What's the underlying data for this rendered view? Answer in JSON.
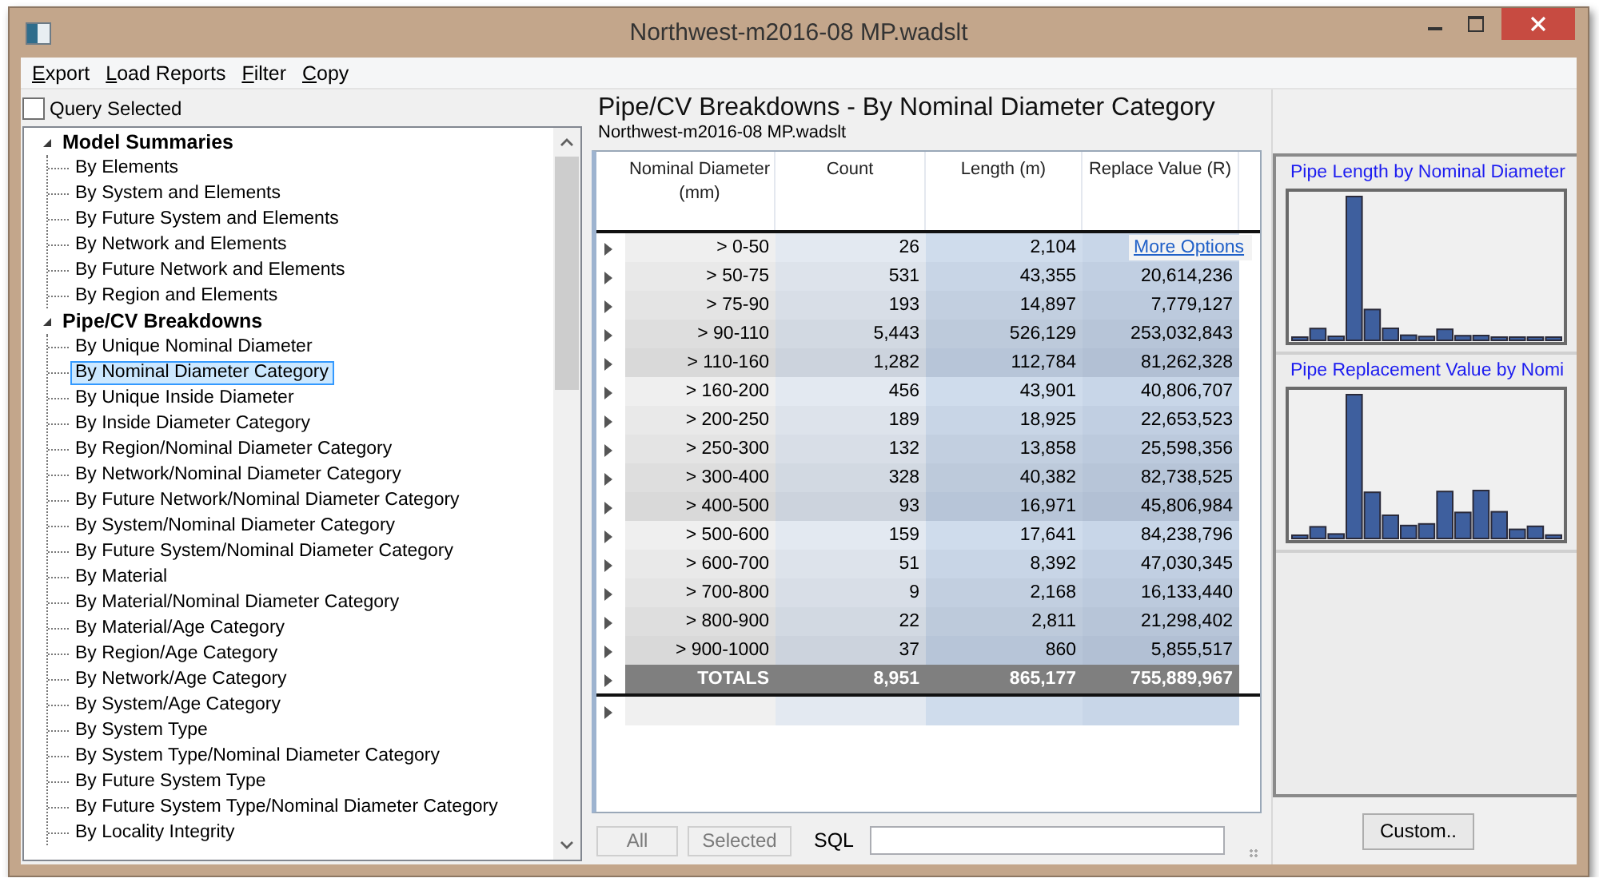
{
  "window": {
    "title": "Northwest-m2016-08 MP.wadslt"
  },
  "menu": [
    {
      "label": "Export"
    },
    {
      "label": "Load Reports"
    },
    {
      "label": "Filter"
    },
    {
      "label": "Copy"
    }
  ],
  "query_selected": {
    "label": "Query Selected",
    "checked": false
  },
  "tree": [
    {
      "label": "Model Summaries",
      "expanded": true,
      "children": [
        {
          "label": "By Elements",
          "selected": false
        },
        {
          "label": "By System and Elements",
          "selected": false
        },
        {
          "label": "By Future System and Elements",
          "selected": false
        },
        {
          "label": "By Network and Elements",
          "selected": false
        },
        {
          "label": "By Future Network and Elements",
          "selected": false
        },
        {
          "label": "By Region and Elements",
          "selected": false
        }
      ]
    },
    {
      "label": "Pipe/CV Breakdowns",
      "expanded": true,
      "children": [
        {
          "label": "By Unique Nominal Diameter",
          "selected": false
        },
        {
          "label": "By Nominal Diameter Category",
          "selected": true
        },
        {
          "label": "By Unique Inside Diameter",
          "selected": false
        },
        {
          "label": "By Inside Diameter Category",
          "selected": false
        },
        {
          "label": "By Region/Nominal Diameter Category",
          "selected": false
        },
        {
          "label": "By Network/Nominal Diameter Category",
          "selected": false
        },
        {
          "label": "By Future Network/Nominal Diameter Category",
          "selected": false
        },
        {
          "label": "By System/Nominal Diameter Category",
          "selected": false
        },
        {
          "label": "By Future System/Nominal Diameter Category",
          "selected": false
        },
        {
          "label": "By Material",
          "selected": false
        },
        {
          "label": "By Material/Nominal Diameter Category",
          "selected": false
        },
        {
          "label": "By Material/Age Category",
          "selected": false
        },
        {
          "label": "By Region/Age Category",
          "selected": false
        },
        {
          "label": "By Network/Age Category",
          "selected": false
        },
        {
          "label": "By System/Age Category",
          "selected": false
        },
        {
          "label": "By System Type",
          "selected": false
        },
        {
          "label": "By System Type/Nominal Diameter Category",
          "selected": false
        },
        {
          "label": "By Future System Type",
          "selected": false
        },
        {
          "label": "By Future System Type/Nominal Diameter Category",
          "selected": false
        },
        {
          "label": "By Locality Integrity",
          "selected": false
        }
      ]
    }
  ],
  "report": {
    "title": "Pipe/CV Breakdowns - By Nominal Diameter Category",
    "subtitle": "Northwest-m2016-08 MP.wadslt"
  },
  "table": {
    "columns": [
      "Nominal Diameter (mm)",
      "Count",
      "Length (m)",
      "Replace Value (R)"
    ],
    "rows": [
      {
        "kind": "data",
        "cells": [
          "> 0-50",
          "26",
          "2,104"
        ]
      },
      {
        "kind": "data",
        "cells": [
          "> 50-75",
          "531",
          "43,355",
          "20,614,236"
        ]
      },
      {
        "kind": "data",
        "cells": [
          "> 75-90",
          "193",
          "14,897",
          "7,779,127"
        ]
      },
      {
        "kind": "data",
        "cells": [
          "> 90-110",
          "5,443",
          "526,129",
          "253,032,843"
        ]
      },
      {
        "kind": "data",
        "cells": [
          "> 110-160",
          "1,282",
          "112,784",
          "81,262,328"
        ]
      },
      {
        "kind": "data",
        "cells": [
          "> 160-200",
          "456",
          "43,901",
          "40,806,707"
        ]
      },
      {
        "kind": "data",
        "cells": [
          "> 200-250",
          "189",
          "18,925",
          "22,653,523"
        ]
      },
      {
        "kind": "data",
        "cells": [
          "> 250-300",
          "132",
          "13,858",
          "25,598,356"
        ]
      },
      {
        "kind": "data",
        "cells": [
          "> 300-400",
          "328",
          "40,382",
          "82,738,525"
        ]
      },
      {
        "kind": "data",
        "cells": [
          "> 400-500",
          "93",
          "16,971",
          "45,806,984"
        ]
      },
      {
        "kind": "data",
        "cells": [
          "> 500-600",
          "159",
          "17,641",
          "84,238,796"
        ]
      },
      {
        "kind": "data",
        "cells": [
          "> 600-700",
          "51",
          "8,392",
          "47,030,345"
        ]
      },
      {
        "kind": "data",
        "cells": [
          "> 700-800",
          "9",
          "2,168",
          "16,133,440"
        ]
      },
      {
        "kind": "data",
        "cells": [
          "> 800-900",
          "22",
          "2,811",
          "21,298,402"
        ]
      },
      {
        "kind": "data",
        "cells": [
          "> 900-1000",
          "37",
          "860",
          "5,855,517"
        ]
      },
      {
        "kind": "totals",
        "cells": [
          "TOTALS",
          "8,951",
          "865,177",
          "755,889,967"
        ]
      },
      {
        "kind": "new"
      }
    ]
  },
  "more_options": "More Options",
  "filter_bar": {
    "buttons": [
      {
        "label": "All",
        "disabled": true
      },
      {
        "label": "Selected",
        "disabled": true
      }
    ],
    "sql_label": "SQL"
  },
  "charts": [
    {
      "title": "Pipe Length by Nominal Diameter",
      "kind": "length"
    },
    {
      "title": "Pipe Replacement Value by Nomi",
      "kind": "replace"
    }
  ],
  "custom_button": "Custom.."
}
